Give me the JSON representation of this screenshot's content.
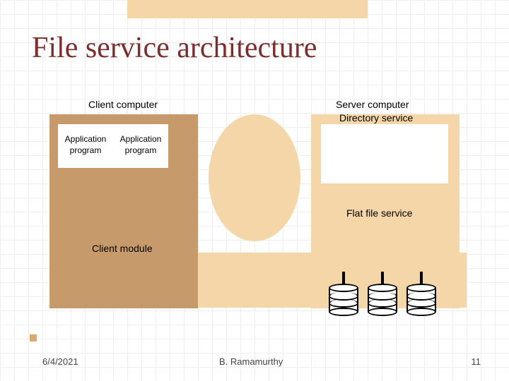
{
  "title": "File service architecture",
  "labels": {
    "client_computer": "Client computer",
    "server_computer": "Server computer",
    "app_program": "Application program",
    "client_module": "Client module",
    "directory_service": "Directory service",
    "flat_file_service": "Flat file service"
  },
  "footer": {
    "date": "6/4/2021",
    "author": "B. Ramamurthy",
    "page": "11"
  }
}
